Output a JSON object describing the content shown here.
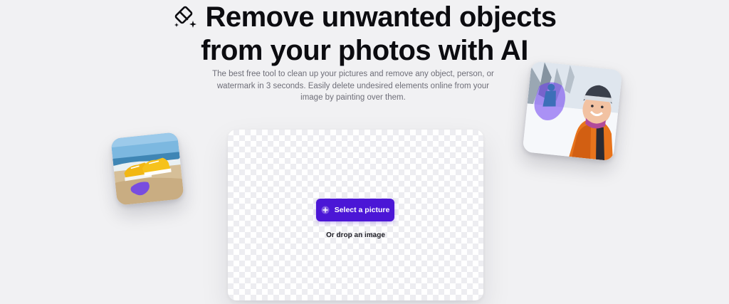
{
  "hero": {
    "title_line1": "Remove unwanted objects",
    "title_line2": "from your photos with AI",
    "title_icon": "eraser-sparkle-icon",
    "subtitle": "The best free tool to clean up your pictures and remove any object, person, or watermark in 3 seconds. Easily delete undesired elements online from your image by painting over them."
  },
  "upload": {
    "select_label": "Select a picture",
    "select_icon": "plus-circle-icon",
    "drop_hint": "Or drop an image"
  },
  "example_photos": [
    {
      "name": "beach-sneakers-photo"
    },
    {
      "name": "snow-hiker-photo"
    }
  ],
  "colors": {
    "accent": "#4b16d6",
    "paint_mask": "#6b3cf0",
    "background": "#f1f1f3",
    "title": "#0c0c10",
    "subtitle": "#6e6e78"
  }
}
